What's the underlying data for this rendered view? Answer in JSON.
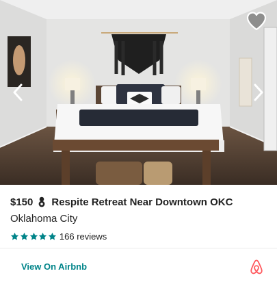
{
  "listing": {
    "price": "$150",
    "title": "Respite Retreat Near Downtown OKC",
    "location": "Oklahoma City",
    "rating": 5,
    "reviews_label": "166 reviews"
  },
  "footer": {
    "link_label": "View On Airbnb"
  },
  "icons": {
    "favorite": "heart-outline-icon",
    "prev": "chevron-left-icon",
    "next": "chevron-right-icon",
    "badge": "superhost-medal-icon",
    "star": "star-icon",
    "brand": "airbnb-logo-icon"
  },
  "colors": {
    "accent": "#008489",
    "brand": "#FF5A5F",
    "text": "#222222",
    "divider": "#EBEBEB"
  }
}
